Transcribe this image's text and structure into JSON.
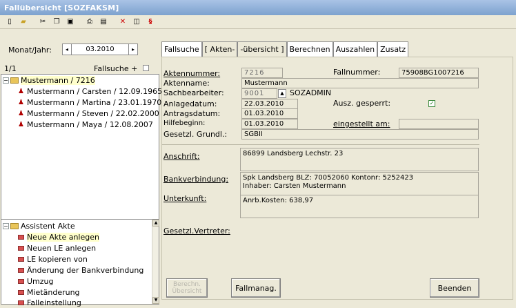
{
  "window": {
    "title": "Fallübersicht [SOZFAKSM]"
  },
  "toolbar": {
    "icons": [
      "new-icon",
      "open-icon",
      "cut-icon",
      "copy-icon",
      "paste-icon",
      "print-preview-icon",
      "print-icon",
      "delete-icon",
      "window-icon",
      "paragraph-icon"
    ],
    "paragraph": "§"
  },
  "left": {
    "monat_label": "Monat/Jahr:",
    "monat_value": "03.2010",
    "count": "1/1",
    "fallsuche_plus": "Fallsuche +",
    "tree": [
      {
        "label": "Mustermann / 7216",
        "level": 0
      },
      {
        "label": "Mustermann / Carsten / 12.09.1965",
        "level": 1
      },
      {
        "label": "Mustermann / Martina / 23.01.1970",
        "level": 1
      },
      {
        "label": "Mustermann / Steven / 22.02.2000",
        "level": 1
      },
      {
        "label": "Mustermann / Maya / 12.08.2007",
        "level": 1
      }
    ],
    "assistant": {
      "title": "Assistent Akte",
      "items": [
        "Neue Akte anlegen",
        "Neuen LE anlegen",
        "LE kopieren von",
        "Änderung der Bankverbindung",
        "Umzug",
        "Mietänderung",
        "Falleinstellung"
      ]
    }
  },
  "tabs": [
    "Fallsuche",
    "[ Akten-",
    "-übersicht ]",
    "Berechnen",
    "Auszahlen",
    "Zusatz"
  ],
  "form": {
    "aktennummer_label": "Aktennummer:",
    "aktennummer": "7216",
    "fallnummer_label": "Fallnummer:",
    "fallnummer": "75908BG1007216",
    "aktenname_label": "Aktenname:",
    "aktenname": "Mustermann",
    "sachbearbeiter_label": "Sachbearbeiter:",
    "sachbearbeiter_code": "9001",
    "sachbearbeiter_name": "SOZADMIN",
    "anlagedatum_label": "Anlagedatum:",
    "anlagedatum": "22.03.2010",
    "ausz_gesperrt_label": "Ausz. gesperrt:",
    "ausz_gesperrt": true,
    "antragsdatum_label": "Antragsdatum:",
    "antragsdatum": "01.03.2010",
    "hilfebeginn_label": "Hilfebeginn:",
    "hilfebeginn": "01.03.2010",
    "eingestellt_label": "eingestellt am:",
    "gesetzl_grundl_label": "Gesetzl. Grundl.:",
    "gesetzl_grundl": "SGBII",
    "anschrift_label": "Anschrift:",
    "anschrift": "86899 Landsberg  Lechstr. 23",
    "bank_label": "Bankverbindung:",
    "bank_line1": "Spk Landsberg BLZ: 70052060 Kontonr: 5252423",
    "bank_line2": "Inhaber: Carsten    Mustermann",
    "unterkunft_label": "Unterkunft:",
    "unterkunft": "Anrb.Kosten: 638,97",
    "vertreter_label": "Gesetzl.Vertreter:"
  },
  "buttons": {
    "berechn_line1": "Berechn.",
    "berechn_line2": "Übersicht",
    "fallmanag": "Fallmanag.",
    "beenden": "Beenden"
  }
}
